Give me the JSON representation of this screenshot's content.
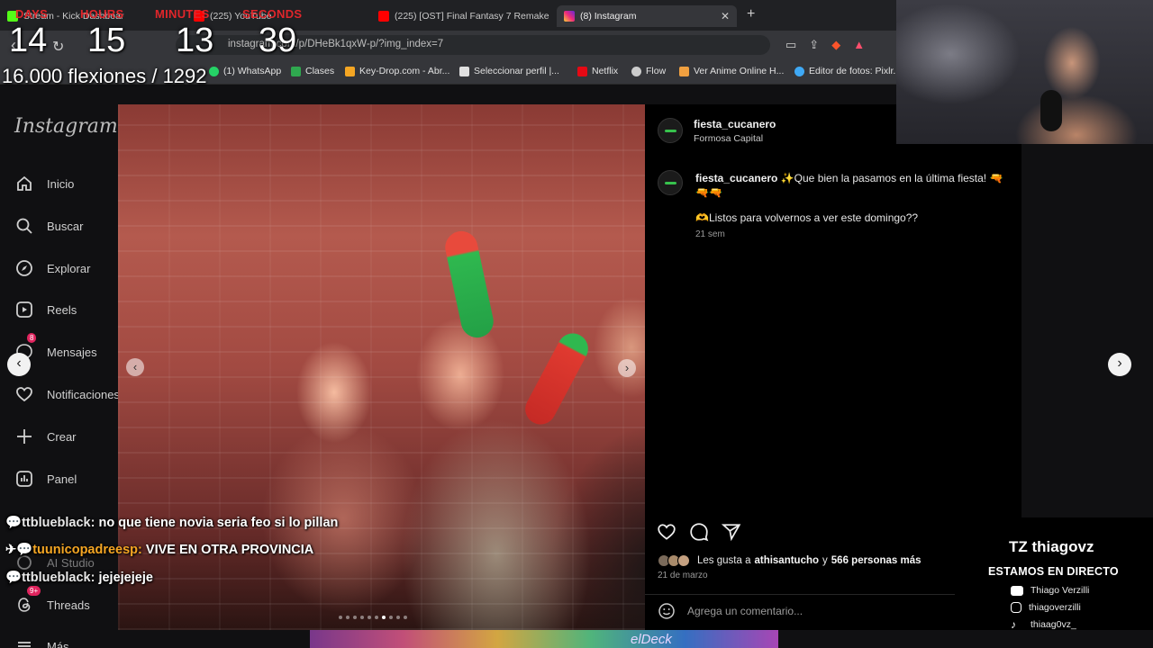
{
  "browser": {
    "tabs": [
      {
        "label": "Stream - Kick Dashboard",
        "icon": "kick-icon"
      },
      {
        "label": "(225) YouTube",
        "icon": "youtube-icon"
      },
      {
        "label": "(225) [OST] Final Fantasy 7 Remake -",
        "icon": "youtube-icon"
      },
      {
        "label": "(8) Instagram",
        "icon": "instagram-icon",
        "active": true
      }
    ],
    "url": "instagram.com/p/DHeBk1qxW-p/?img_index=7",
    "bookmarks": [
      {
        "label": "(1) WhatsApp",
        "icon": "whatsapp-icon",
        "color": "#25d366"
      },
      {
        "label": "Clases",
        "icon": "classroom-icon",
        "color": "#2fa84f"
      },
      {
        "label": "Key-Drop.com - Abr...",
        "icon": "keydrop-icon",
        "color": "#f5a623"
      },
      {
        "label": "Seleccionar perfil |...",
        "icon": "profile-icon",
        "color": "#e0e0e0"
      },
      {
        "label": "Netflix",
        "icon": "netflix-icon",
        "color": "#e50914"
      },
      {
        "label": "Flow",
        "icon": "flow-icon",
        "color": "#cccccc"
      },
      {
        "label": "Ver Anime Online H...",
        "icon": "anime-icon",
        "color": "#f0a040"
      },
      {
        "label": "Editor de fotos: Pixlr...",
        "icon": "pixlr-icon",
        "color": "#3fa9f5"
      }
    ]
  },
  "timer": {
    "labels": [
      "DAYS",
      "HOURS",
      "MINUTES",
      "SECONDS"
    ],
    "values": [
      "14",
      "15",
      "13",
      "39"
    ],
    "counter": "16.000 flexiones / 1292"
  },
  "instagram": {
    "logo": "Instagram",
    "nav": [
      {
        "label": "Inicio",
        "icon": "home-icon"
      },
      {
        "label": "Buscar",
        "icon": "search-icon"
      },
      {
        "label": "Explorar",
        "icon": "compass-icon"
      },
      {
        "label": "Reels",
        "icon": "reels-icon"
      },
      {
        "label": "Mensajes",
        "icon": "messenger-icon",
        "badge": "8"
      },
      {
        "label": "Notificaciones",
        "icon": "heart-icon"
      },
      {
        "label": "Crear",
        "icon": "plus-icon"
      },
      {
        "label": "Panel",
        "icon": "chart-icon"
      },
      {
        "label": "AI Studio",
        "icon": "ai-studio-icon"
      },
      {
        "label": "Threads",
        "icon": "threads-icon",
        "badge": "9+"
      },
      {
        "label": "Más",
        "icon": "menu-icon"
      }
    ],
    "post": {
      "username": "fiesta_cucanero",
      "location": "Formosa Capital",
      "caption_line1": "✨Que bien la pasamos en la última fiesta! 🔫🔫🔫",
      "caption_line2": "🫶Listos para volvernos a ver este domingo??",
      "caption_age": "21 sem",
      "likes_prefix": "Les gusta a",
      "likes_user": "athisantucho",
      "likes_mid": "y",
      "likes_count": "566 personas más",
      "date": "21 de marzo",
      "comment_placeholder": "Agrega un comentario...",
      "carousel_total": 10,
      "carousel_index": 7
    }
  },
  "chat": [
    {
      "user": "ttblueblack:",
      "message": "no que tiene novia seria feo si lo pillan",
      "color": "#e8e8e8"
    },
    {
      "user": "tuunicopadreesp:",
      "message": "VIVE EN OTRA PROVINCIA",
      "color": "#f5a623"
    },
    {
      "user": "ttblueblack:",
      "message": "jejejejeje",
      "color": "#e8e8e8"
    }
  ],
  "socials": {
    "brand": "thiagovz",
    "live": "ESTAMOS EN DIRECTO",
    "items": [
      {
        "label": "Thiago Verzilli",
        "icon": "youtube-icon"
      },
      {
        "label": "thiagoverzilli",
        "icon": "instagram-icon"
      },
      {
        "label": "thiaag0vz_",
        "icon": "tiktok-icon"
      }
    ]
  },
  "bottom_banner": "elDeck"
}
